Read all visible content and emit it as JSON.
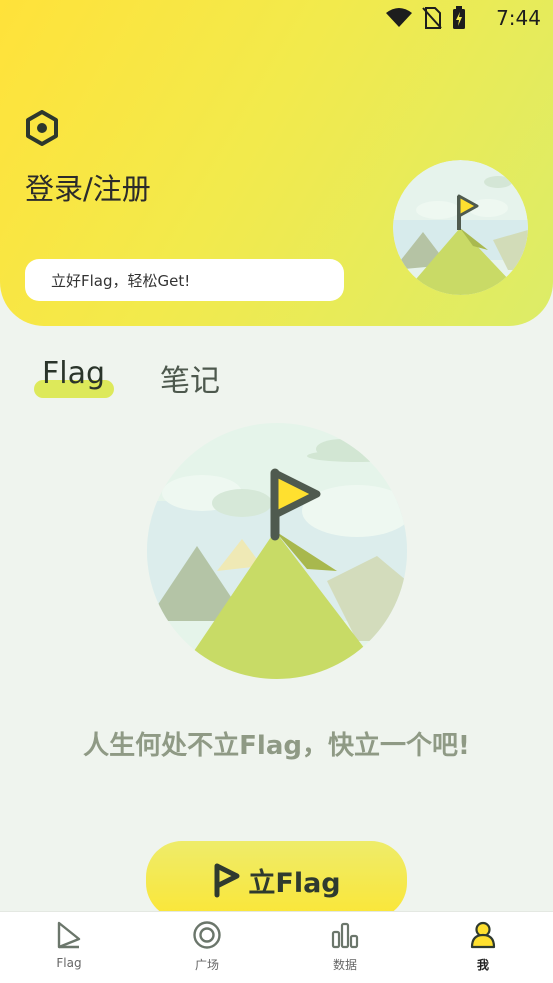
{
  "status_bar": {
    "time": "7:44"
  },
  "header": {
    "login_label": "登录/注册",
    "slogan": "立好Flag，轻松Get!"
  },
  "tabs": [
    {
      "label": "Flag",
      "active": true
    },
    {
      "label": "笔记",
      "active": false
    }
  ],
  "empty_state": {
    "message": "人生何处不立Flag，快立一个吧!"
  },
  "cta": {
    "label": "立Flag"
  },
  "bottom_nav": [
    {
      "label": "Flag",
      "icon": "flag-nav-icon",
      "active": false
    },
    {
      "label": "广场",
      "icon": "square-nav-icon",
      "active": false
    },
    {
      "label": "数据",
      "icon": "chart-nav-icon",
      "active": false
    },
    {
      "label": "我",
      "icon": "me-nav-icon",
      "active": true
    }
  ],
  "colors": {
    "header_start": "#ffe23a",
    "header_end": "#dcec68",
    "background": "#eff4ee",
    "tab_underline": "#dde95a",
    "empty_text": "#8f9a85",
    "flag_yellow": "#ffe02f"
  }
}
